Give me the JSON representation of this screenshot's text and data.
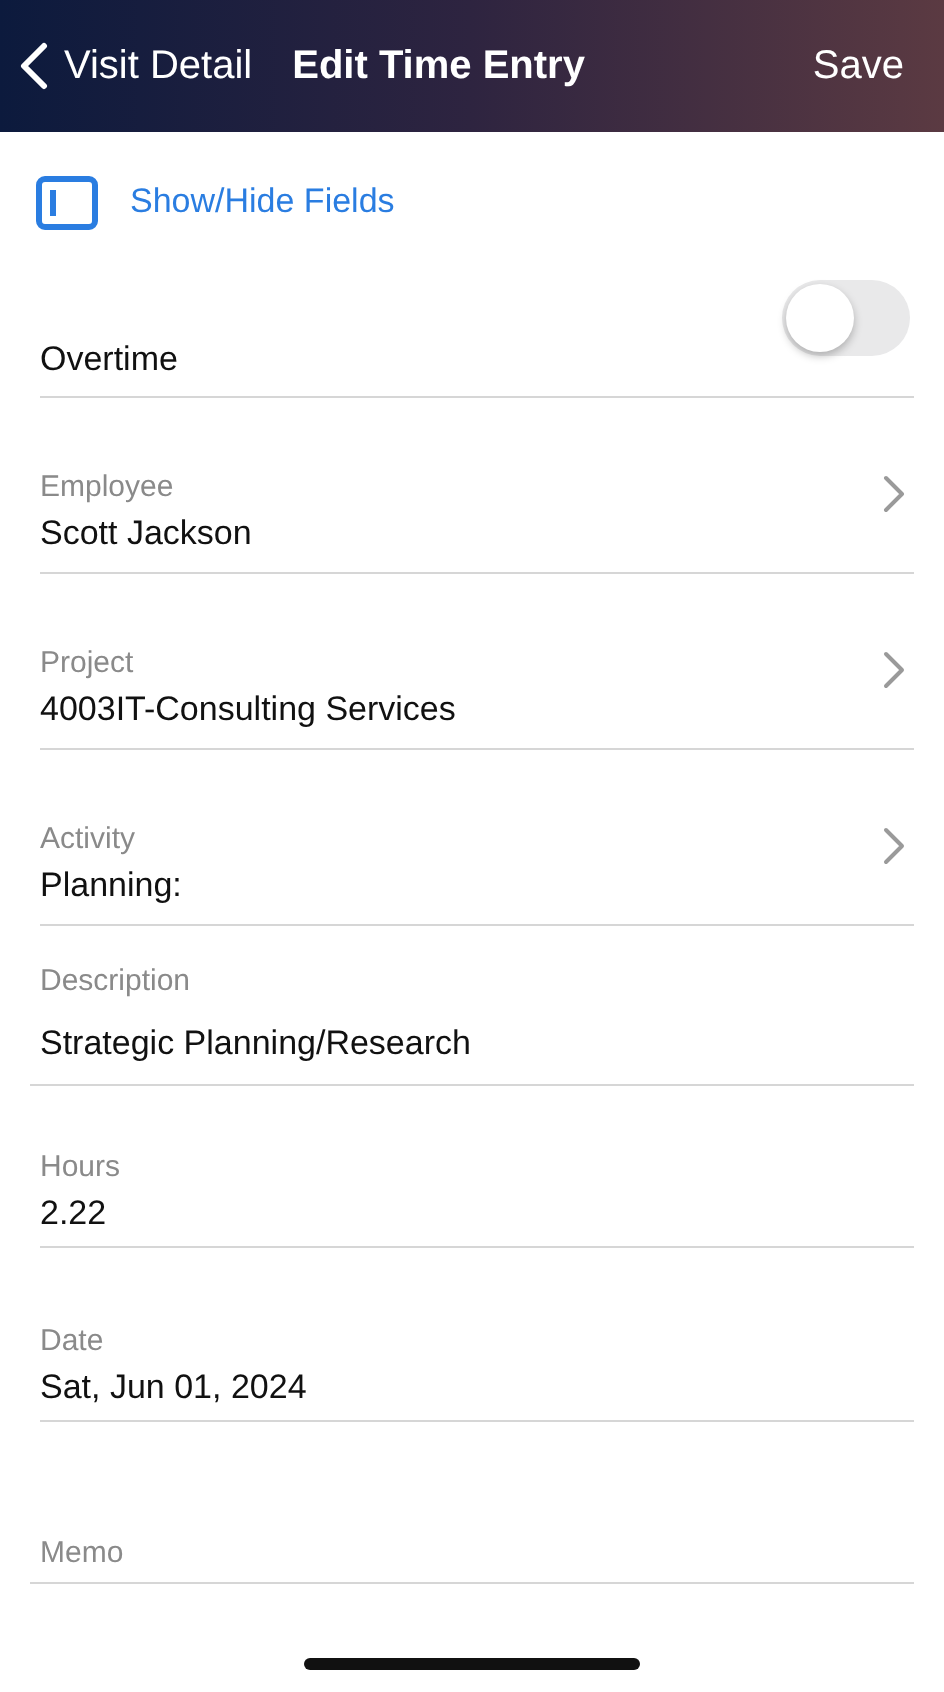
{
  "header": {
    "back": "Visit Detail",
    "title": "Edit Time Entry",
    "action": "Save"
  },
  "show_hide": {
    "label": "Show/Hide Fields"
  },
  "fields": [
    {
      "kind": "toggle",
      "label": "Overtime",
      "on": false
    },
    {
      "kind": "picker",
      "label": "Employee",
      "value": "Scott Jackson"
    },
    {
      "kind": "picker",
      "label": "Project",
      "value": "4003IT-Consulting Services"
    },
    {
      "kind": "picker",
      "label": "Activity",
      "value": "Planning:"
    },
    {
      "kind": "textarea",
      "label": "Description",
      "value": "Strategic Planning/Research"
    },
    {
      "kind": "input",
      "label": "Hours",
      "value": "2.22"
    },
    {
      "kind": "date",
      "label": "Date",
      "value": "Sat, Jun 01, 2024"
    },
    {
      "kind": "memo",
      "label": "Memo"
    }
  ]
}
